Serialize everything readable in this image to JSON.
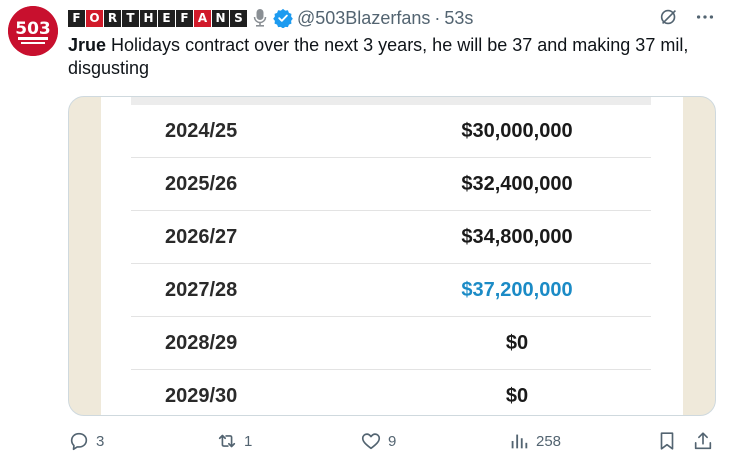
{
  "account": {
    "brand_letters": [
      "F",
      "O",
      "R",
      "T",
      "H",
      "E",
      "F",
      "A",
      "N",
      "S"
    ],
    "handle": "@503Blazerfans",
    "separator": "·",
    "time": "53s",
    "avatar_text": "503"
  },
  "tweet": {
    "bold_lead": "Jrue",
    "text": " Holidays contract over the next 3 years, he will be 37 and making 37 mil, disgusting"
  },
  "contract_table": {
    "rows": [
      {
        "season": "2024/25",
        "amount": "$30,000,000",
        "highlight": false
      },
      {
        "season": "2025/26",
        "amount": "$32,400,000",
        "highlight": false
      },
      {
        "season": "2026/27",
        "amount": "$34,800,000",
        "highlight": false
      },
      {
        "season": "2027/28",
        "amount": "$37,200,000",
        "highlight": true
      },
      {
        "season": "2028/29",
        "amount": "$0",
        "highlight": false
      },
      {
        "season": "2029/30",
        "amount": "$0",
        "highlight": false
      }
    ]
  },
  "actions": {
    "reply_count": "3",
    "retweet_count": "1",
    "like_count": "9",
    "views_count": "258"
  },
  "colors": {
    "brand_red": "#d11a2a",
    "link_blue": "#1b8bc6",
    "verified_blue": "#1d9bf0",
    "muted": "#536471"
  }
}
